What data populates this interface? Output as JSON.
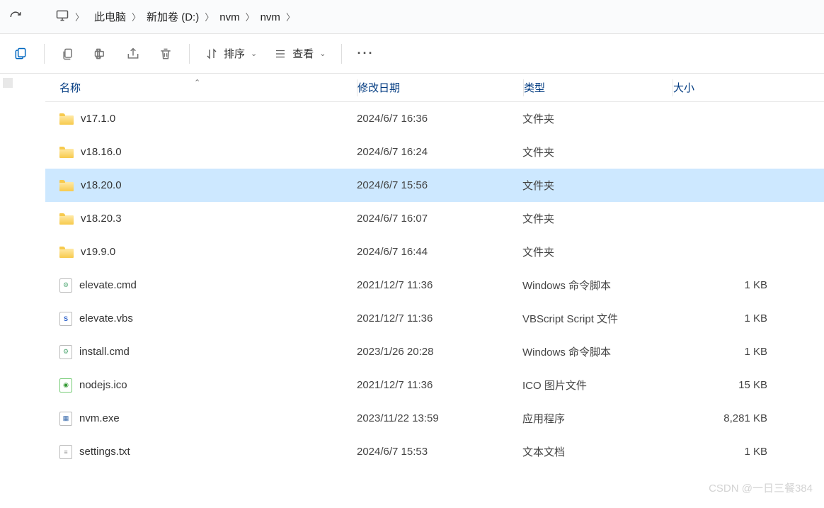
{
  "breadcrumb": {
    "items": [
      "此电脑",
      "新加卷 (D:)",
      "nvm",
      "nvm"
    ]
  },
  "toolbar": {
    "sort_label": "排序",
    "view_label": "查看"
  },
  "columns": {
    "name": "名称",
    "date": "修改日期",
    "type": "类型",
    "size": "大小"
  },
  "files": [
    {
      "name": "v17.1.0",
      "date": "2024/6/7 16:36",
      "type": "文件夹",
      "size": "",
      "icon": "folder",
      "selected": false
    },
    {
      "name": "v18.16.0",
      "date": "2024/6/7 16:24",
      "type": "文件夹",
      "size": "",
      "icon": "folder",
      "selected": false
    },
    {
      "name": "v18.20.0",
      "date": "2024/6/7 15:56",
      "type": "文件夹",
      "size": "",
      "icon": "folder",
      "selected": true
    },
    {
      "name": "v18.20.3",
      "date": "2024/6/7 16:07",
      "type": "文件夹",
      "size": "",
      "icon": "folder",
      "selected": false
    },
    {
      "name": "v19.9.0",
      "date": "2024/6/7 16:44",
      "type": "文件夹",
      "size": "",
      "icon": "folder",
      "selected": false
    },
    {
      "name": "elevate.cmd",
      "date": "2021/12/7 11:36",
      "type": "Windows 命令脚本",
      "size": "1 KB",
      "icon": "cmd",
      "selected": false
    },
    {
      "name": "elevate.vbs",
      "date": "2021/12/7 11:36",
      "type": "VBScript Script 文件",
      "size": "1 KB",
      "icon": "vbs",
      "selected": false
    },
    {
      "name": "install.cmd",
      "date": "2023/1/26 20:28",
      "type": "Windows 命令脚本",
      "size": "1 KB",
      "icon": "cmd",
      "selected": false
    },
    {
      "name": "nodejs.ico",
      "date": "2021/12/7 11:36",
      "type": "ICO 图片文件",
      "size": "15 KB",
      "icon": "ico",
      "selected": false
    },
    {
      "name": "nvm.exe",
      "date": "2023/11/22 13:59",
      "type": "应用程序",
      "size": "8,281 KB",
      "icon": "exe",
      "selected": false
    },
    {
      "name": "settings.txt",
      "date": "2024/6/7 15:53",
      "type": "文本文档",
      "size": "1 KB",
      "icon": "txt",
      "selected": false
    }
  ],
  "watermark": "CSDN @一日三餐384"
}
